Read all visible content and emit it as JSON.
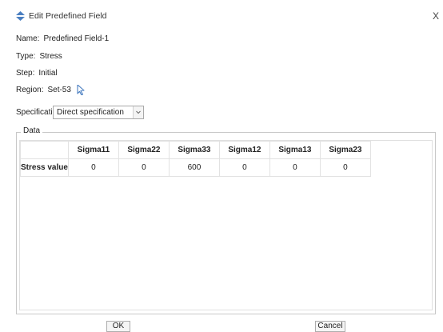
{
  "window": {
    "title": "Edit Predefined Field",
    "close_label": "X"
  },
  "info": {
    "name_label": "Name:",
    "name_value": "Predefined Field-1",
    "type_label": "Type:",
    "type_value": "Stress",
    "step_label": "Step:",
    "step_value": "Initial",
    "region_label": "Region:",
    "region_value": "Set-53"
  },
  "specification": {
    "label": "Specification:",
    "selected": "Direct specification"
  },
  "data_group": {
    "title": "Data",
    "columns": [
      "Sigma11",
      "Sigma22",
      "Sigma33",
      "Sigma12",
      "Sigma13",
      "Sigma23"
    ],
    "rows": [
      {
        "label": "Stress value",
        "values": [
          "0",
          "0",
          "600",
          "0",
          "0",
          "0"
        ]
      }
    ]
  },
  "buttons": {
    "ok": "OK",
    "cancel": "Cancel"
  },
  "colors": {
    "accent": "#4a7fc1",
    "border": "#c8c8c8",
    "grid_line": "#e2e2e2"
  }
}
